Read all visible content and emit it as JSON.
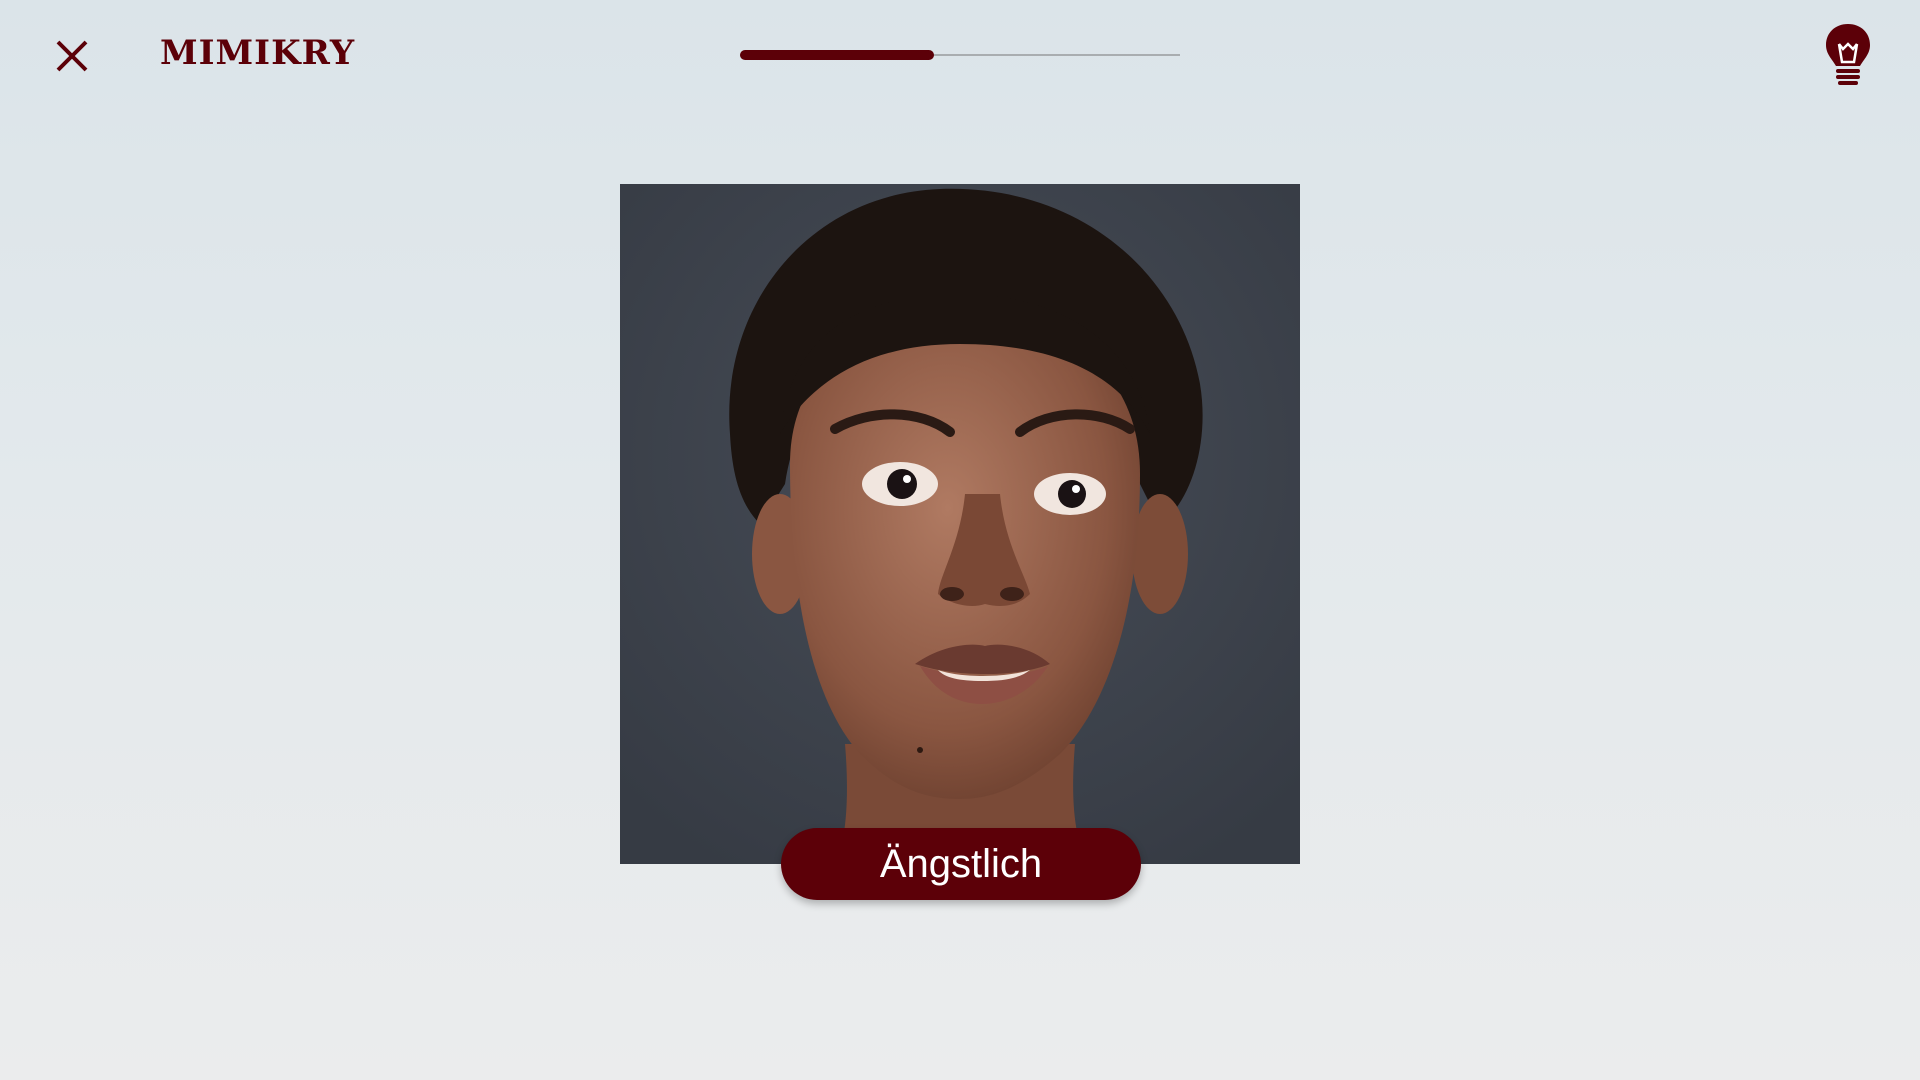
{
  "app": {
    "title": "MIMIKRY",
    "accent_color": "#5c0008"
  },
  "toolbar": {
    "close_icon": "close-icon",
    "hint_icon": "lightbulb-icon"
  },
  "progress": {
    "fraction": 0.44
  },
  "face_card": {
    "image": "portrait of woman with fearful facial expression",
    "emotion_label": "Ängstlich"
  }
}
